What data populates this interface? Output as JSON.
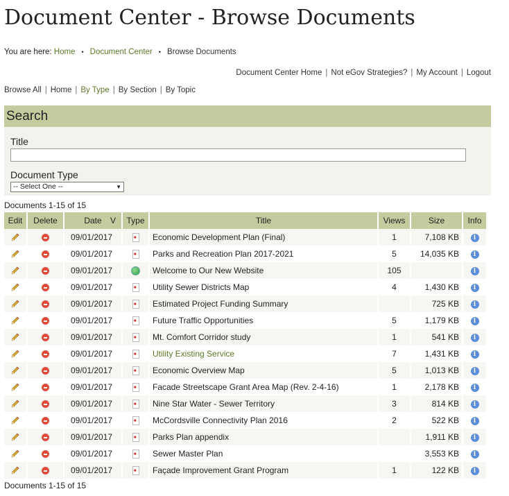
{
  "page_title": "Document Center - Browse Documents",
  "breadcrumb": {
    "prefix": "You are here: ",
    "items": [
      "Home",
      "Document Center",
      "Browse Documents"
    ],
    "separator": "•"
  },
  "top_links": [
    "Document Center Home",
    "Not eGov Strategies?",
    "My Account",
    "Logout"
  ],
  "browse_links": [
    "Browse All",
    "Home",
    "By Type",
    "By Section",
    "By Topic"
  ],
  "search": {
    "heading": "Search",
    "title_label": "Title",
    "title_value": "",
    "doc_type_label": "Document Type",
    "doc_type_selected": "-- Select One --"
  },
  "count_text": "Documents 1-15 of 15",
  "table": {
    "headers": {
      "edit": "Edit",
      "delete": "Delete",
      "date": "Date",
      "sort": "V",
      "type": "Type",
      "title": "Title",
      "views": "Views",
      "size": "Size",
      "info": "Info"
    },
    "rows": [
      {
        "date": "09/01/2017",
        "type": "pdf",
        "title": "Economic Development Plan (Final)",
        "views": "1",
        "size": "7,108 KB"
      },
      {
        "date": "09/01/2017",
        "type": "pdf",
        "title": "Parks and Recreation Plan 2017-2021",
        "views": "5",
        "size": "14,035 KB"
      },
      {
        "date": "09/01/2017",
        "type": "web",
        "title": "Welcome to Our New Website",
        "views": "105",
        "size": ""
      },
      {
        "date": "09/01/2017",
        "type": "pdf",
        "title": "Utility Sewer Districts Map",
        "views": "4",
        "size": "1,430 KB"
      },
      {
        "date": "09/01/2017",
        "type": "pdf",
        "title": "Estimated Project Funding Summary",
        "views": "",
        "size": "725 KB"
      },
      {
        "date": "09/01/2017",
        "type": "pdf",
        "title": "Future Traffic Opportunities",
        "views": "5",
        "size": "1,179 KB"
      },
      {
        "date": "09/01/2017",
        "type": "pdf",
        "title": "Mt. Comfort Corridor study",
        "views": "1",
        "size": "541 KB"
      },
      {
        "date": "09/01/2017",
        "type": "pdf",
        "title": "Utility Existing Service",
        "views": "7",
        "size": "1,431 KB"
      },
      {
        "date": "09/01/2017",
        "type": "pdf",
        "title": "Economic Overview Map",
        "views": "5",
        "size": "1,013 KB"
      },
      {
        "date": "09/01/2017",
        "type": "pdf",
        "title": "Facade Streetscape Grant Area Map (Rev. 2-4-16)",
        "views": "1",
        "size": "2,178 KB"
      },
      {
        "date": "09/01/2017",
        "type": "pdf",
        "title": "Nine Star Water - Sewer Territory",
        "views": "3",
        "size": "814 KB"
      },
      {
        "date": "09/01/2017",
        "type": "pdf",
        "title": "McCordsville Connectivity Plan 2016",
        "views": "2",
        "size": "522 KB"
      },
      {
        "date": "09/01/2017",
        "type": "pdf",
        "title": "Parks Plan appendix",
        "views": "",
        "size": "1,911 KB"
      },
      {
        "date": "09/01/2017",
        "type": "pdf",
        "title": "Sewer Master Plan",
        "views": "",
        "size": "3,553 KB"
      },
      {
        "date": "09/01/2017",
        "type": "pdf",
        "title": "Façade Improvement Grant Program",
        "views": "1",
        "size": "122 KB"
      }
    ]
  },
  "colors": {
    "header_bg": "#c5cb9e",
    "link_green": "#5a7a2a",
    "search_bg": "#f2f3ec"
  }
}
